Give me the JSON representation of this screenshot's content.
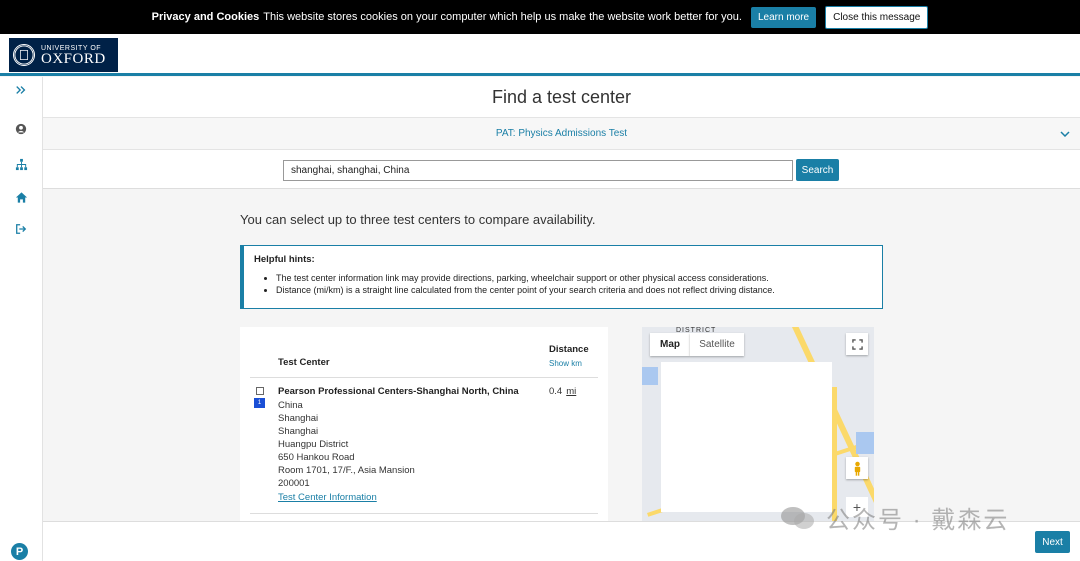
{
  "cookie": {
    "title": "Privacy and Cookies",
    "message": "This website stores cookies on your computer which help us make the website work better for you.",
    "learn_more": "Learn more",
    "close": "Close this message"
  },
  "header": {
    "logo_line1": "UNIVERSITY OF",
    "logo_line2": "OXFORD"
  },
  "sidebar": {
    "icons": [
      "expand-icon",
      "user-icon",
      "sitemap-icon",
      "home-icon",
      "logout-icon"
    ]
  },
  "page": {
    "title": "Find a test center",
    "exam": "PAT: Physics Admissions Test"
  },
  "search": {
    "value": "shanghai, shanghai, China",
    "button": "Search"
  },
  "intro": "You can select up to three test centers to compare availability.",
  "hints": {
    "title": "Helpful hints:",
    "items": [
      "The test center information link may provide directions, parking, wheelchair support or other physical access considerations.",
      "Distance (mi/km) is a straight line calculated from the center point of your search criteria and does not reflect driving distance."
    ]
  },
  "results": {
    "header_center": "Test Center",
    "header_distance": "Distance",
    "show_km": "Show km",
    "rows": [
      {
        "pin": "1",
        "name": "Pearson Professional Centers-Shanghai North, China",
        "address": [
          "China",
          "Shanghai",
          "Shanghai",
          "Huangpu District",
          "650 Hankou Road",
          "Room 1701, 17/F., Asia Mansion",
          "200001"
        ],
        "link": "Test Center Information",
        "distance": "0.4",
        "unit": "mi"
      }
    ]
  },
  "map": {
    "district_label": "DISTRICT",
    "tab_map": "Map",
    "tab_satellite": "Satellite"
  },
  "footer": {
    "next": "Next",
    "pearson": "P"
  },
  "watermark": "公众号 · 戴森云"
}
